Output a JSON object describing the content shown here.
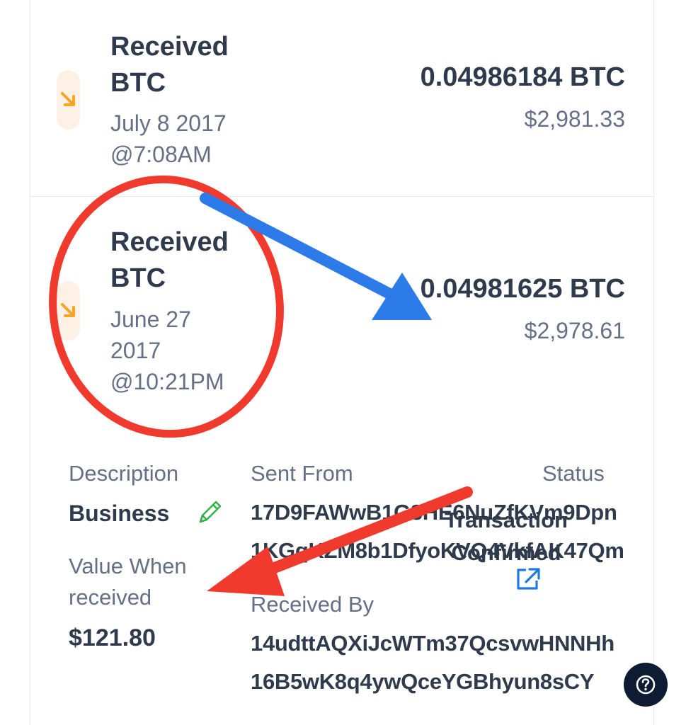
{
  "transactions": [
    {
      "direction_icon": "arrow-down-right-icon",
      "title_line1": "Received",
      "title_line2": "BTC",
      "date_line1": "July 8 2017",
      "date_line2": "@7:08AM",
      "amount_crypto": "0.04986184 BTC",
      "amount_fiat": "$2,981.33"
    },
    {
      "direction_icon": "arrow-down-right-icon",
      "title_line1": "Received",
      "title_line2": "BTC",
      "date_line1": "June 27",
      "date_line2": "2017",
      "date_line3": "@10:21PM",
      "amount_crypto": "0.04981625 BTC",
      "amount_fiat": "$2,978.61"
    }
  ],
  "details": {
    "description_label": "Description",
    "description_value": "Business",
    "edit_icon": "pencil-icon",
    "value_when_received_label_line1": "Value When",
    "value_when_received_label_line2": "received",
    "value_when_received": "$121.80",
    "sent_from_label": "Sent From",
    "sent_from": [
      "17D9FAWwB1G3HE6NuZfKVm9Dpn",
      "1KGqKZM8b1DfyoKVQ4VkfAK47Qm"
    ],
    "received_by_label": "Received By",
    "received_by": [
      "14udttAQXiJcWTm37QcsvwHNNHh",
      "16B5wK8q4ywQceYGBhyun8sCY"
    ],
    "status_label": "Status",
    "status_line1": "Transaction",
    "status_line2": "Confirmed",
    "external_link_icon": "external-link-icon"
  },
  "help_icon": "question-circle-icon",
  "colors": {
    "text_primary": "#2f3b4c",
    "text_secondary": "#657087",
    "received_accent": "#f5a623",
    "received_badge_bg": "#fdf1e5",
    "link_blue": "#1f7ae0",
    "annotation_red": "#ef3a2d",
    "annotation_blue": "#2d7be8",
    "help_button_bg": "#0e1c33"
  }
}
